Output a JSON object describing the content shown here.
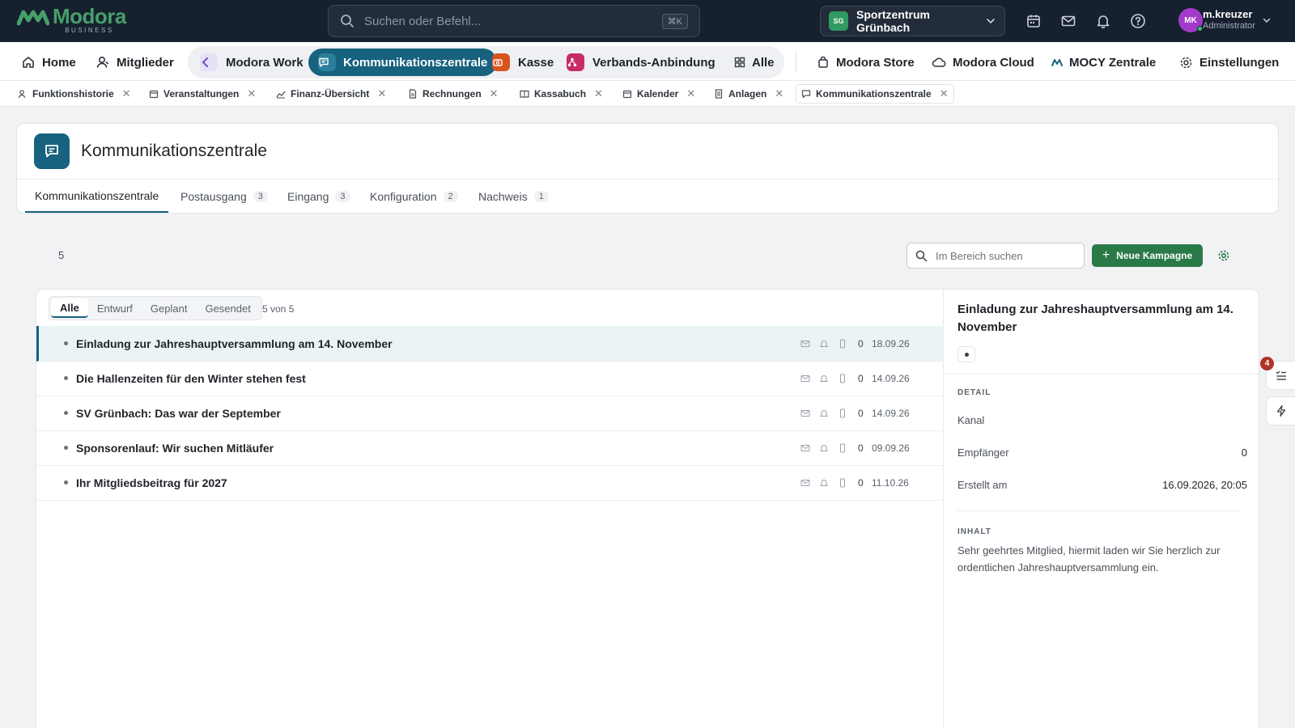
{
  "brand": {
    "name": "Modora",
    "sub": "BUSINESS"
  },
  "search": {
    "placeholder": "Suchen oder Befehl...",
    "shortcut": "⌘K"
  },
  "org": {
    "initials": "SG",
    "name": "Sportzentrum Grünbach"
  },
  "top_icons": [
    "calendar-icon",
    "mail-icon",
    "bell-icon",
    "help-icon"
  ],
  "user": {
    "initials": "MK",
    "name": "m.kreuzer",
    "role": "Administrator"
  },
  "mainnav": {
    "home": "Home",
    "members": "Mitglieder",
    "apps": [
      {
        "label": "Modora Work",
        "color": "#6b4fc8"
      },
      {
        "label": "Kommunikationszentrale",
        "color": "#17627e",
        "active": true
      },
      {
        "label": "Kasse",
        "color": "#d9531e"
      },
      {
        "label": "Verbands-Anbindung",
        "color": "#c72c63"
      },
      {
        "label": "Alle"
      }
    ],
    "store": "Modora Store",
    "cloud": "Modora Cloud",
    "mocy": "MOCY Zentrale",
    "settings": "Einstellungen"
  },
  "tabs": [
    {
      "label": "Funktionshistorie",
      "icon": "user-clock-icon"
    },
    {
      "label": "Veranstaltungen",
      "icon": "calendar-icon"
    },
    {
      "label": "Finanz-Übersicht",
      "icon": "chart-line-icon"
    },
    {
      "label": "Rechnungen",
      "icon": "file-icon"
    },
    {
      "label": "Kassabuch",
      "icon": "book-icon"
    },
    {
      "label": "Kalender",
      "icon": "calendar-icon"
    },
    {
      "label": "Anlagen",
      "icon": "document-icon"
    },
    {
      "label": "Kommunikationszentrale",
      "icon": "message-icon",
      "active": true
    }
  ],
  "page": {
    "title": "Kommunikationszentrale",
    "subtabs": [
      {
        "label": "Kommunikationszentrale",
        "count": ""
      },
      {
        "label": "Postausgang",
        "count": "3"
      },
      {
        "label": "Eingang",
        "count": "3"
      },
      {
        "label": "Konfiguration",
        "count": "2"
      },
      {
        "label": "Nachweis",
        "count": "1"
      }
    ],
    "total": "5",
    "area_search_placeholder": "Im Bereich suchen",
    "new_button": "Neue Kampagne"
  },
  "filters": {
    "items": [
      "Alle",
      "Entwurf",
      "Geplant",
      "Gesendet"
    ],
    "active": "Alle",
    "count_text": "5 von 5"
  },
  "campaigns": [
    {
      "title": "Einladung zur Jahreshauptversammlung am 14. November",
      "count": "0",
      "date": "18.09.26",
      "selected": true
    },
    {
      "title": "Die Hallenzeiten für den Winter stehen fest",
      "count": "0",
      "date": "14.09.26"
    },
    {
      "title": "SV Grünbach: Das war der September",
      "count": "0",
      "date": "14.09.26"
    },
    {
      "title": "Sponsorenlauf: Wir suchen Mitläufer",
      "count": "0",
      "date": "09.09.26"
    },
    {
      "title": "Ihr Mitgliedsbeitrag für 2027",
      "count": "0",
      "date": "11.10.26"
    }
  ],
  "detail": {
    "title": "Einladung zur Jahreshauptversammlung am 14. November",
    "section_detail": "DETAIL",
    "rows": [
      {
        "label": "Kanal",
        "value": ""
      },
      {
        "label": "Empfänger",
        "value": "0"
      },
      {
        "label": "Erstellt am",
        "value": "16.09.2026, 20:05"
      }
    ],
    "section_content": "INHALT",
    "content": "Sehr geehrtes Mitglied, hiermit laden wir Sie herzlich zur ordentlichen Jahreshauptversammlung ein."
  },
  "rail": {
    "badge": "4"
  },
  "colors": {
    "brand_green": "#45a06a",
    "accent": "#17627e",
    "primary_button": "#2a7a48",
    "topbar": "#17202f"
  }
}
